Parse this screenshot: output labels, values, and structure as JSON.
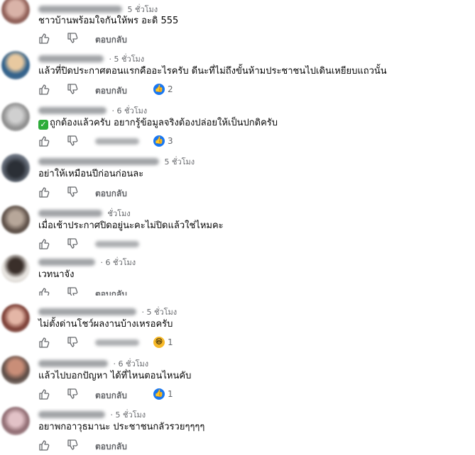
{
  "colors": {
    "like": "#1877f2",
    "haha": "#f7b928",
    "check": "#2eac3a",
    "meta": "#65676b"
  },
  "icons": {
    "like": "thumbs-up-icon",
    "dislike": "thumbs-down-icon"
  },
  "comments": [
    {
      "time": "5 ชั่วโมง",
      "text": "ชาวบ้านพร้อมใจกันให้พร อะดิ 555",
      "reply": "ตอบกลับ",
      "reaction": null
    },
    {
      "time": "· 5 ชั่วโมง",
      "text": "แล้วที่ปิดประกาศตอนแรกคืออะไรครับ ดีนะที่ไม่ถึงขั้นห้ามประชาชนไปเดินเหยียบแถวนั้น",
      "reply": "ตอบกลับ",
      "reaction": {
        "type": "like",
        "count": "2"
      }
    },
    {
      "time": "· 6 ชั่วโมง",
      "text": "ถูกต้องแล้วครับ อยากรู้ข้อมูลจริงต้องปล่อยให้เป็นปกติครับ",
      "reply": "",
      "reaction": {
        "type": "like",
        "count": "3"
      },
      "check": "✓"
    },
    {
      "time": "5 ชั่วโมง",
      "text": "อย่าให้เหมือนปีก่อนก่อนละ",
      "reply": "ตอบกลับ",
      "reaction": null
    },
    {
      "time": "ชั่วโมง",
      "text": "เมื่อเช้าประกาศปิดอยู่นะคะไม่ปิดแล้วใช่ไหมคะ",
      "reply": "",
      "reaction": null
    },
    {
      "time": "· 6 ชั่วโมง",
      "text": "เวทนาจัง",
      "reply": "ตอบกลับ",
      "reaction": null
    },
    {
      "time": "· 5 ชั่วโมง",
      "text": "ไม่ตั้งด่านโชว์ผลงานบ้างเหรอครับ",
      "reply": "",
      "reaction": {
        "type": "haha",
        "count": "1"
      }
    },
    {
      "time": "· 6 ชั่วโมง",
      "text": "แล้วไปบอกปัญหา ได้ที่ไหนตอนไหนคับ",
      "reply": "ตอบกลับ",
      "reaction": {
        "type": "like",
        "count": "1"
      }
    },
    {
      "time": "· 5 ชั่วโมง",
      "text": "อยาพกอาวุธมานะ ประชาชนกลัวรวยๆๆๆๆ",
      "reply": "ตอบกลับ",
      "reaction": null
    }
  ]
}
